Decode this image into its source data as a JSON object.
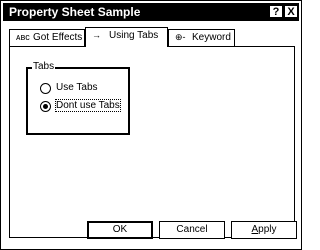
{
  "window": {
    "title": "Property Sheet Sample",
    "help_glyph": "?",
    "close_glyph": "X"
  },
  "tabs": [
    {
      "label": "Got Effects",
      "icon_glyph": "ᴀʙᴄ",
      "icon": "font-icon",
      "active": false
    },
    {
      "label": "Using Tabs",
      "icon_glyph": "→",
      "icon": "arrow-icon",
      "active": true
    },
    {
      "label": "Keyword",
      "icon_glyph": "⊕-",
      "icon": "key-icon",
      "active": false
    }
  ],
  "group": {
    "title": "Tabs",
    "options": [
      {
        "label": "Use Tabs",
        "selected": false
      },
      {
        "label": "Dont use Tabs",
        "selected": true
      }
    ]
  },
  "buttons": {
    "ok": "OK",
    "cancel": "Cancel",
    "apply_first": "A",
    "apply_rest": "pply"
  }
}
